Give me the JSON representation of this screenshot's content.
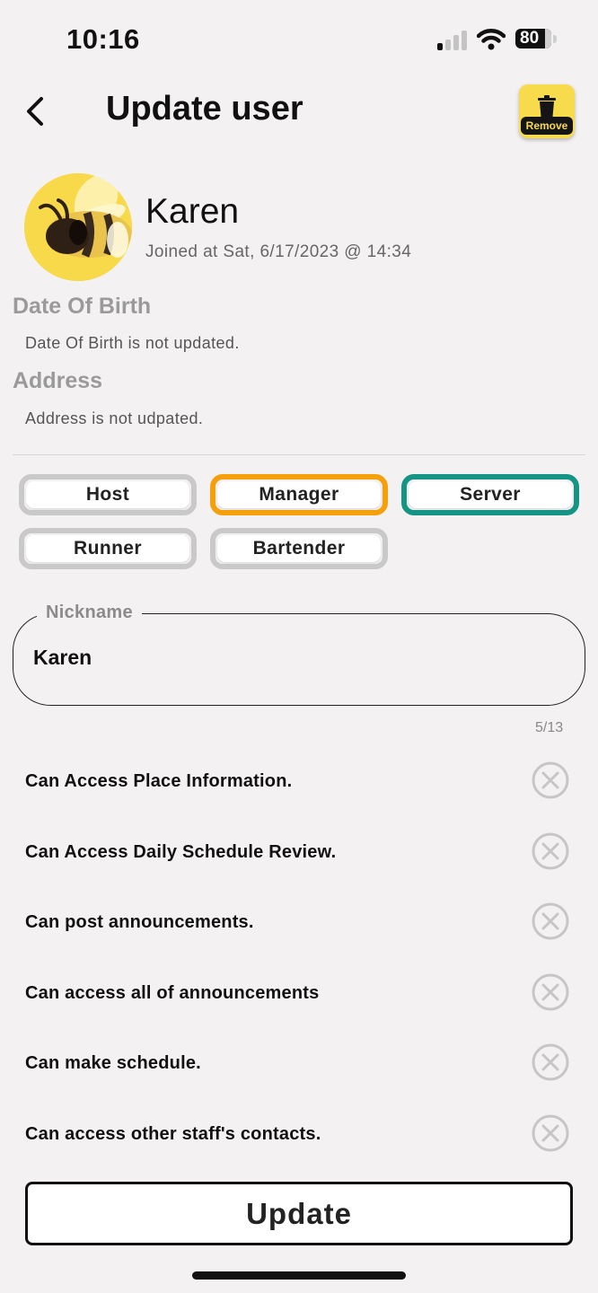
{
  "status_bar": {
    "time": "10:16",
    "battery": "80"
  },
  "header": {
    "title": "Update user",
    "remove_label": "Remove"
  },
  "user": {
    "name": "Karen",
    "joined": "Joined at Sat, 6/17/2023 @ 14:34"
  },
  "date_of_birth": {
    "title": "Date Of Birth",
    "text": "Date Of Birth is not updated."
  },
  "address": {
    "title": "Address",
    "text": "Address is not udpated."
  },
  "roles": [
    {
      "label": "Host",
      "border": "#c9c9c9"
    },
    {
      "label": "Manager",
      "border": "#f5a00a"
    },
    {
      "label": "Server",
      "border": "#149485"
    },
    {
      "label": "Runner",
      "border": "#c9c9c9"
    },
    {
      "label": "Bartender",
      "border": "#c9c9c9"
    }
  ],
  "nickname": {
    "label": "Nickname",
    "value": "Karen",
    "counter": "5/13"
  },
  "permissions": [
    {
      "label": "Can Access Place Information.",
      "icon": "x-circle-icon"
    },
    {
      "label": "Can Access Daily Schedule Review.",
      "icon": "x-circle-icon"
    },
    {
      "label": "Can post announcements.",
      "icon": "x-circle-icon"
    },
    {
      "label": "Can access all of announcements",
      "icon": "x-circle-icon"
    },
    {
      "label": "Can make schedule.",
      "icon": "x-circle-icon"
    },
    {
      "label": "Can access other staff's contacts.",
      "icon": "x-circle-icon"
    }
  ],
  "footer": {
    "update_label": "Update"
  }
}
